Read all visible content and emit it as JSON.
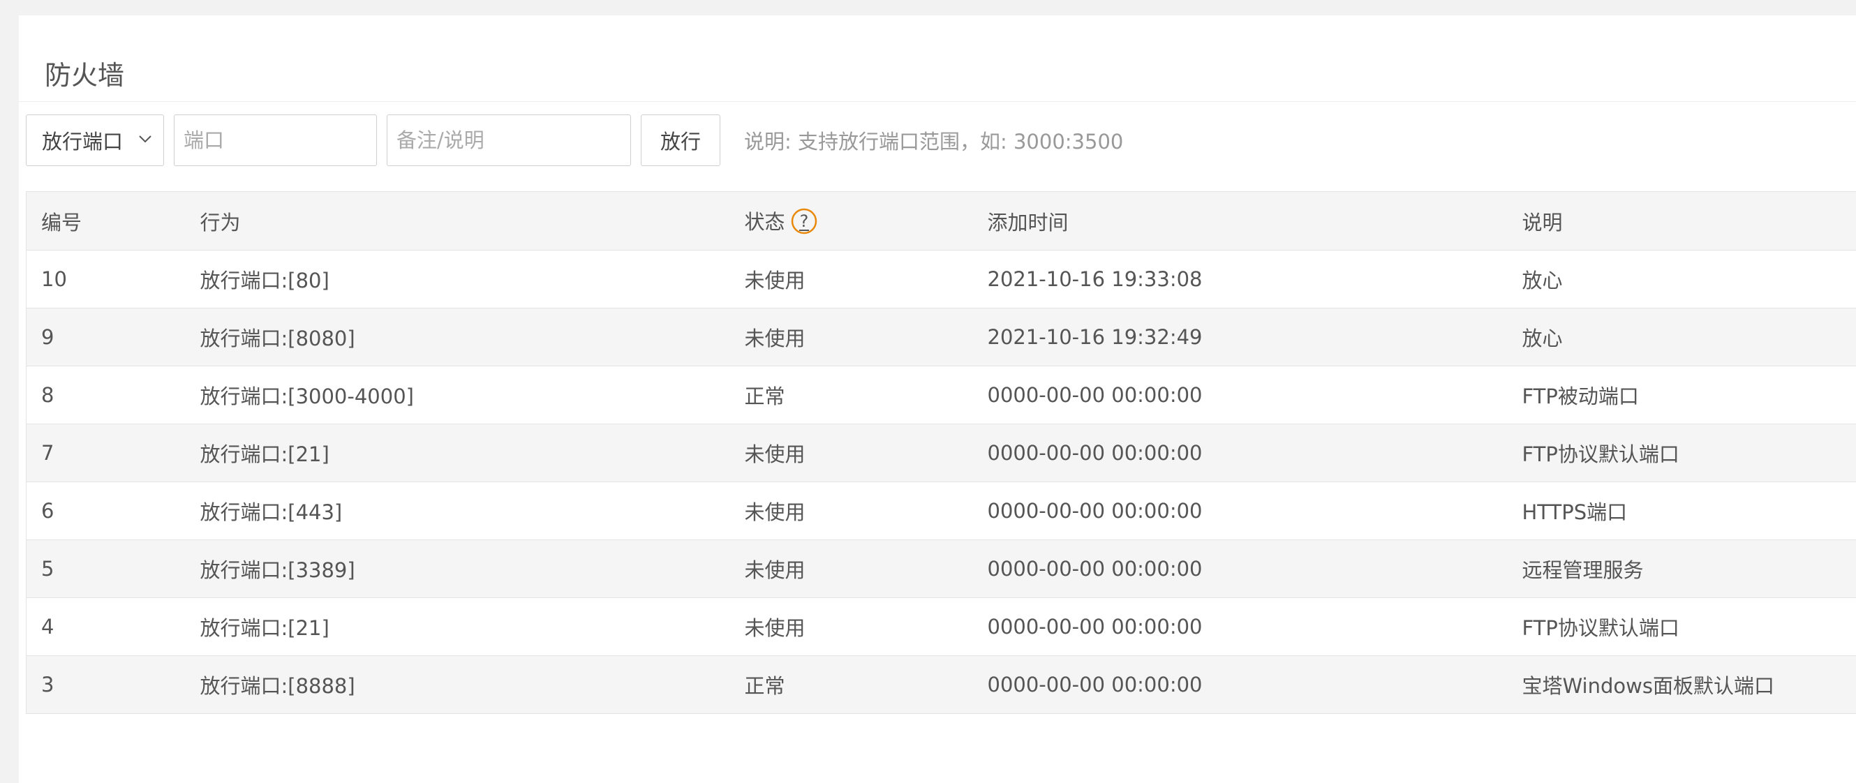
{
  "page": {
    "title": "防火墙"
  },
  "toolbar": {
    "select_value": "放行端口",
    "port_placeholder": "端口",
    "note_placeholder": "备注/说明",
    "submit_label": "放行",
    "hint": "说明: 支持放行端口范围，如: 3000:3500"
  },
  "table": {
    "headers": {
      "id": "编号",
      "action": "行为",
      "status": "状态",
      "time": "添加时间",
      "note": "说明"
    },
    "rows": [
      {
        "id": "10",
        "action": "放行端口:[80]",
        "status": "未使用",
        "time": "2021-10-16 19:33:08",
        "note": "放心"
      },
      {
        "id": "9",
        "action": "放行端口:[8080]",
        "status": "未使用",
        "time": "2021-10-16 19:32:49",
        "note": "放心"
      },
      {
        "id": "8",
        "action": "放行端口:[3000-4000]",
        "status": "正常",
        "time": "0000-00-00 00:00:00",
        "note": "FTP被动端口"
      },
      {
        "id": "7",
        "action": "放行端口:[21]",
        "status": "未使用",
        "time": "0000-00-00 00:00:00",
        "note": "FTP协议默认端口"
      },
      {
        "id": "6",
        "action": "放行端口:[443]",
        "status": "未使用",
        "time": "0000-00-00 00:00:00",
        "note": "HTTPS端口"
      },
      {
        "id": "5",
        "action": "放行端口:[3389]",
        "status": "未使用",
        "time": "0000-00-00 00:00:00",
        "note": "远程管理服务"
      },
      {
        "id": "4",
        "action": "放行端口:[21]",
        "status": "未使用",
        "time": "0000-00-00 00:00:00",
        "note": "FTP协议默认端口"
      },
      {
        "id": "3",
        "action": "放行端口:[8888]",
        "status": "正常",
        "time": "0000-00-00 00:00:00",
        "note": "宝塔Windows面板默认端口"
      }
    ]
  },
  "icons": {
    "help": "help-circle-icon",
    "dropdown": "chevron-down-icon"
  },
  "colors": {
    "help_icon_accent": "#e8890c",
    "row_alt_bg": "#f5f5f5"
  }
}
